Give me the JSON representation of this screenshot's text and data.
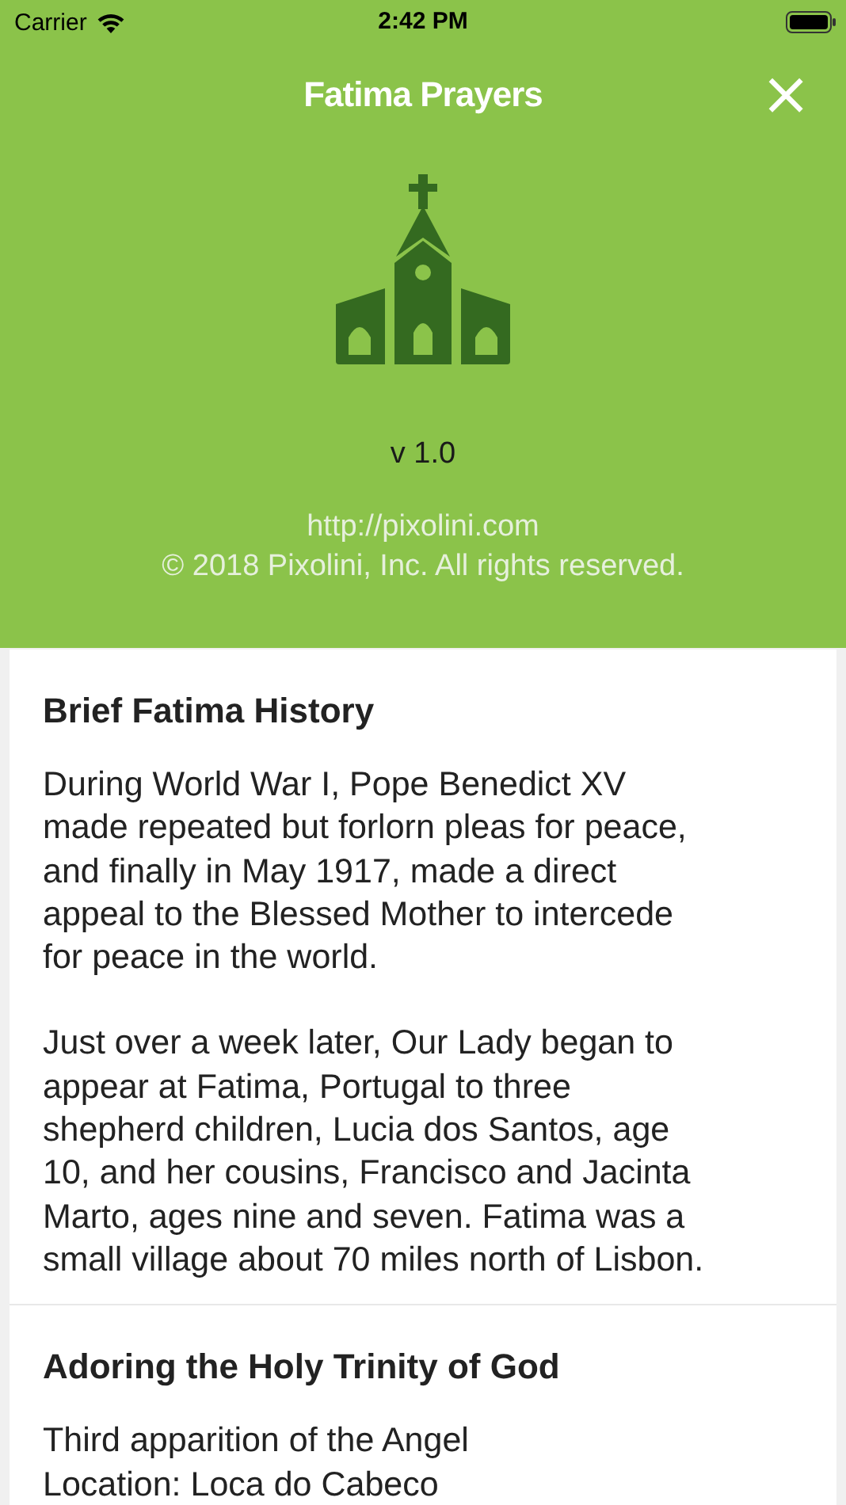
{
  "status_bar": {
    "carrier": "Carrier",
    "time": "2:42 PM"
  },
  "nav": {
    "title": "Fatima Prayers",
    "close": "×"
  },
  "about": {
    "version": "v 1.0",
    "url": "http://pixolini.com",
    "copyright": "© 2018 Pixolini, Inc. All rights reserved."
  },
  "sections": [
    {
      "title": "Brief Fatima History",
      "paragraphs": [
        "During World War I, Pope Benedict XV\nmade repeated but forlorn pleas for peace,\nand finally in May 1917, made a direct\nappeal to the Blessed Mother to intercede\nfor peace in the world.",
        "Just over a week later, Our Lady began to\nappear at Fatima, Portugal to three\nshepherd children, Lucia dos Santos, age\n10, and her cousins, Francisco and Jacinta\nMarto, ages nine and seven. Fatima was a\nsmall village about 70 miles north of Lisbon."
      ]
    },
    {
      "title": "Adoring the Holy Trinity of God",
      "paragraphs": [
        "Third apparition of the Angel\nLocation: Loca do Cabeco"
      ]
    }
  ]
}
